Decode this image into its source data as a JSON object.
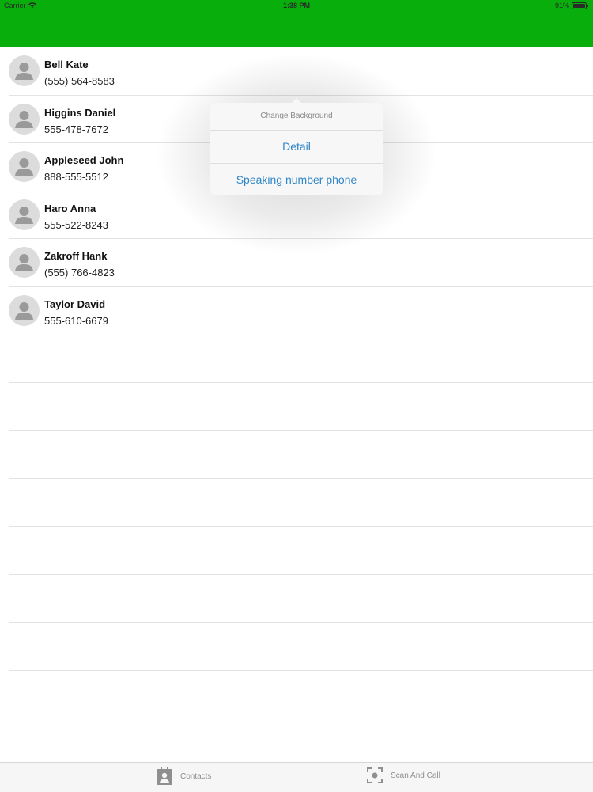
{
  "status_bar": {
    "carrier": "Carrier",
    "time": "1:38 PM",
    "battery": "91%"
  },
  "contacts": [
    {
      "name": "Bell Kate",
      "phone": "(555) 564-8583"
    },
    {
      "name": "Higgins Daniel",
      "phone": "555-478-7672"
    },
    {
      "name": "Appleseed John",
      "phone": "888-555-5512"
    },
    {
      "name": "Haro Anna",
      "phone": "555-522-8243"
    },
    {
      "name": "Zakroff Hank",
      "phone": "(555) 766-4823"
    },
    {
      "name": "Taylor David",
      "phone": "555-610-6679"
    }
  ],
  "popover": {
    "title": "Change Background",
    "actions": [
      "Detail",
      "Speaking number phone"
    ]
  },
  "tab_bar": {
    "items": [
      {
        "label": "Contacts",
        "icon": "contacts-icon"
      },
      {
        "label": "Scan And Call",
        "icon": "scan-icon"
      }
    ]
  },
  "colors": {
    "nav_bar": "#08ae0b",
    "action_text": "#2f86c8"
  }
}
